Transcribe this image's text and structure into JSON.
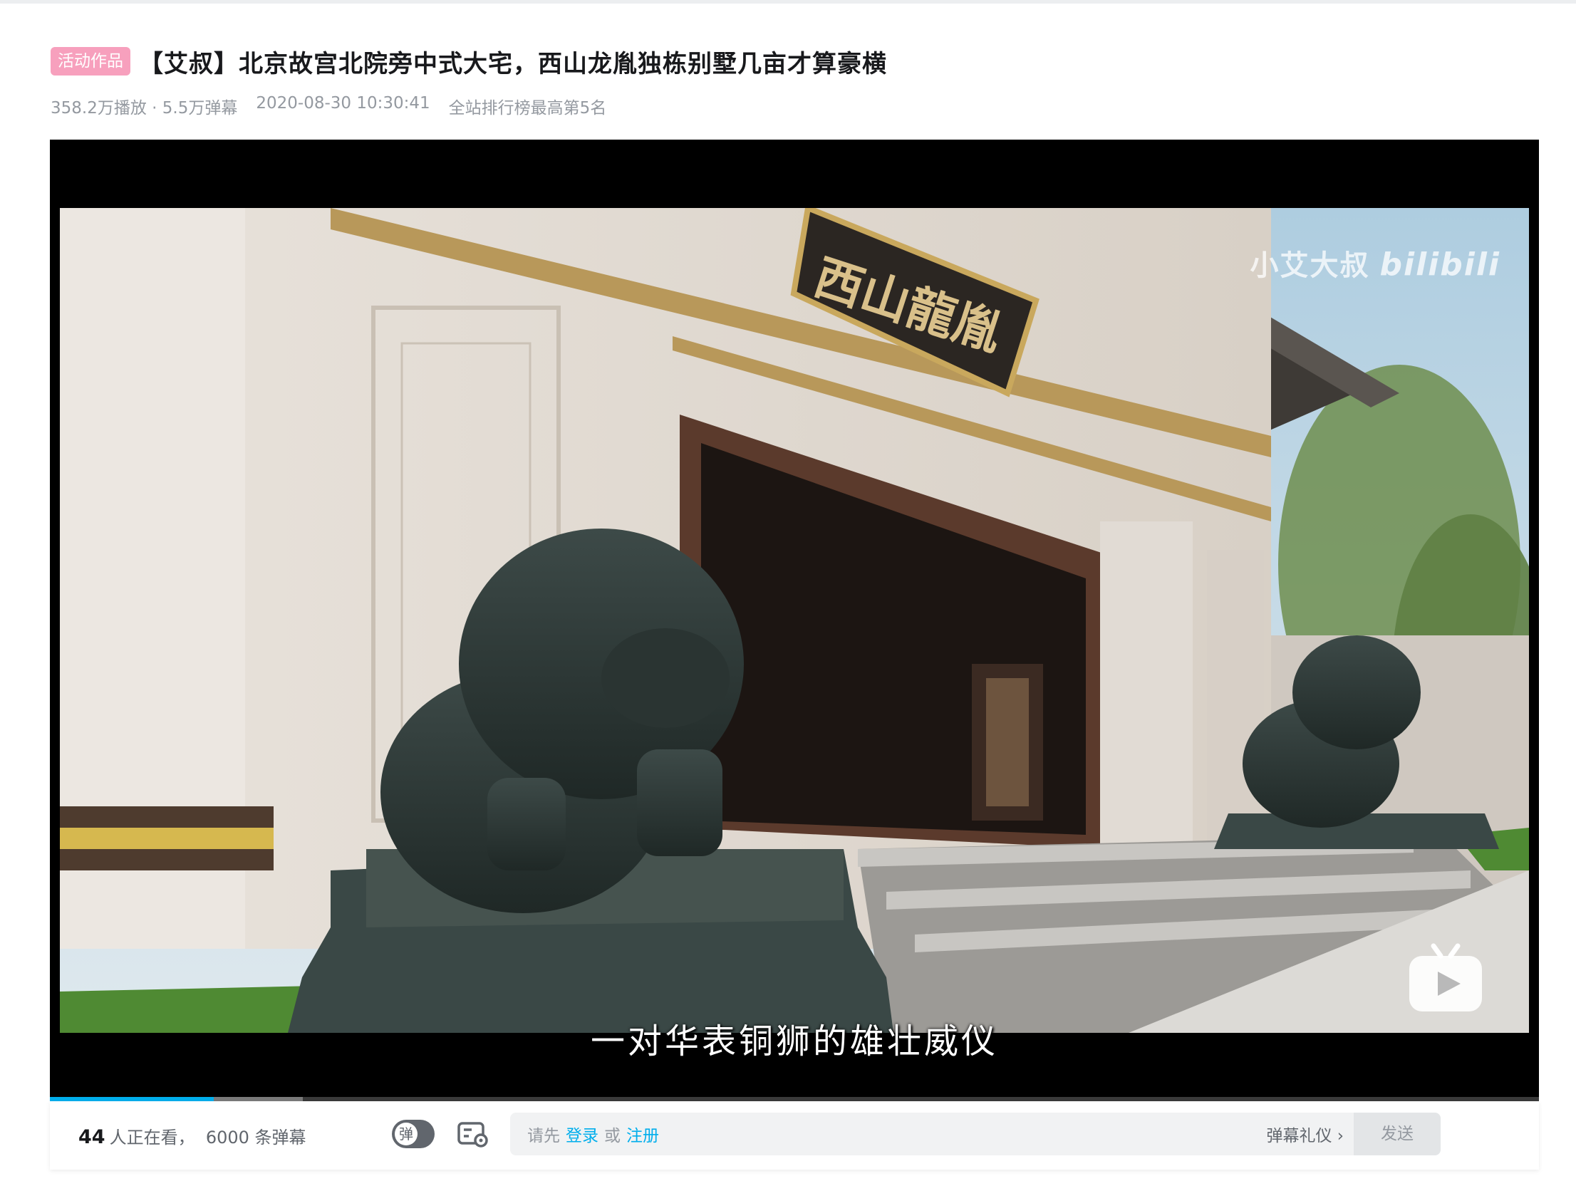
{
  "header": {
    "badge": "活动作品",
    "title": "【艾叔】北京故宫北院旁中式大宅，西山龙胤独栋别墅几亩才算豪横",
    "plays": "358.2万播放 · 5.5万弹幕",
    "date": "2020-08-30 10:30:41",
    "rank": "全站排行榜最高第5名"
  },
  "video": {
    "subtitle": "一对华表铜狮的雄壮威仪",
    "watermark_text": "小艾大叔",
    "watermark_logo": "bilibili",
    "sign_text": "西山龍胤",
    "progress_played": 0.11,
    "progress_buffered": 0.17
  },
  "bar": {
    "viewers_count": "44",
    "viewers_label": "人正在看，",
    "danmaku_count_text": "6000 条弹幕",
    "toggle_label": "弹",
    "prompt_prefix": "请先",
    "login": "登录",
    "or": "或",
    "register": "注册",
    "etiquette": "弹幕礼仪 ›",
    "send": "发送"
  },
  "colors": {
    "accent": "#00aeec",
    "badge": "#f7a0bd"
  },
  "icons": [
    "danmaku-toggle-icon",
    "danmaku-settings-icon",
    "bilibili-tv-icon",
    "chevron-right-icon"
  ]
}
